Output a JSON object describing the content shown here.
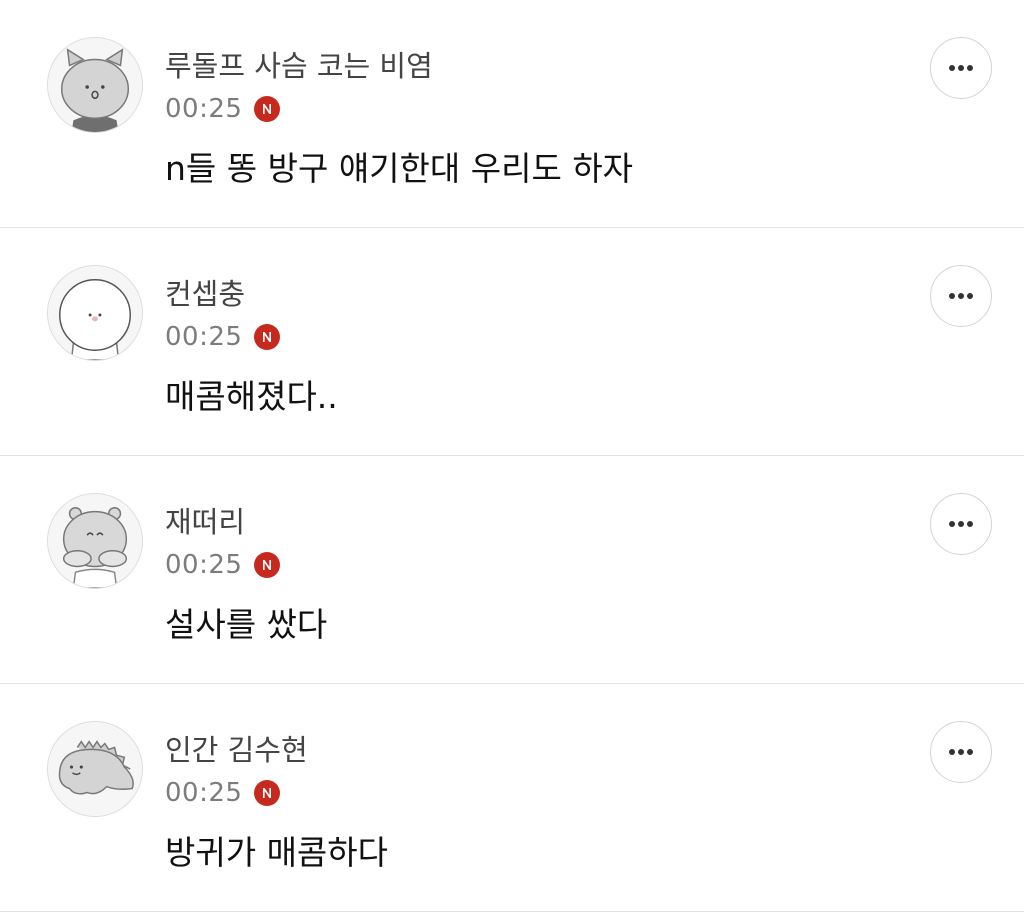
{
  "comments": [
    {
      "author": "루돌프 사슴 코는 비염",
      "time": "00:25",
      "badge": "N",
      "text": "n들 똥 방구 얘기한대 우리도 하자",
      "avatar_icon": "cat-avatar-icon"
    },
    {
      "author": "컨셉충",
      "time": "00:25",
      "badge": "N",
      "text": "매콤해졌다..",
      "avatar_icon": "round-face-avatar-icon"
    },
    {
      "author": "재떠리",
      "time": "00:25",
      "badge": "N",
      "text": "설사를 쌌다",
      "avatar_icon": "bear-avatar-icon"
    },
    {
      "author": "인간 김수현",
      "time": "00:25",
      "badge": "N",
      "text": "방귀가 매콤하다",
      "avatar_icon": "dino-avatar-icon"
    }
  ],
  "colors": {
    "badge": "#c62a1f",
    "divider": "#e2e2e2",
    "author": "#444444",
    "time": "#7c7c7c",
    "text": "#111111"
  }
}
